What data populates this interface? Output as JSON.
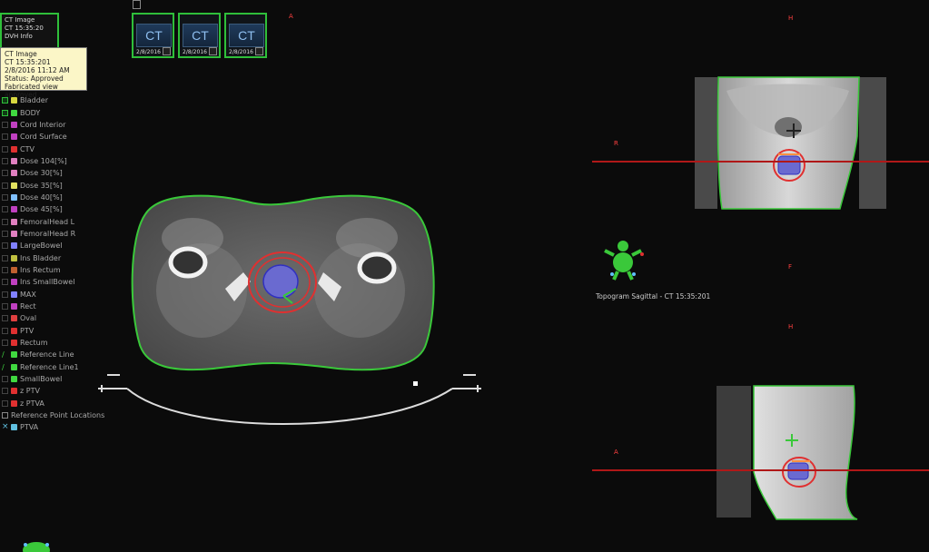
{
  "image_panel": {
    "line1": "CT Image",
    "line2": "CT 15:35:20",
    "line3": "DVH Info"
  },
  "tooltip": {
    "line1": "CT Image",
    "line2": "CT 15:35:201",
    "line3": "2/8/2016 11:12 AM",
    "line4": "Status: Approved",
    "line5": "Fabricated view approved"
  },
  "thumbnails": [
    {
      "label": "CT",
      "date": "2/8/2016"
    },
    {
      "label": "CT",
      "date": "2/8/2016"
    },
    {
      "label": "CT",
      "date": "2/8/2016"
    }
  ],
  "structures": [
    {
      "name": "Bladder",
      "color": "#d8d840",
      "check": "green"
    },
    {
      "name": "BODY",
      "color": "#40d840",
      "check": "green"
    },
    {
      "name": "Cord Interior",
      "color": "#c040c0",
      "check": "none"
    },
    {
      "name": "Cord Surface",
      "color": "#c040c0",
      "check": "none"
    },
    {
      "name": "CTV",
      "color": "#e03030",
      "check": "none"
    },
    {
      "name": "Dose 104[%]",
      "color": "#e080c0",
      "check": "none"
    },
    {
      "name": "Dose 30[%]",
      "color": "#e080c0",
      "check": "none"
    },
    {
      "name": "Dose 35[%]",
      "color": "#e0e060",
      "check": "none"
    },
    {
      "name": "Dose 40[%]",
      "color": "#80c0ff",
      "check": "none"
    },
    {
      "name": "Dose 45[%]",
      "color": "#c040c0",
      "check": "none"
    },
    {
      "name": "FemoralHead L",
      "color": "#e080c0",
      "check": "none"
    },
    {
      "name": "FemoralHead R",
      "color": "#e080c0",
      "check": "none"
    },
    {
      "name": "LargeBowel",
      "color": "#8080ff",
      "check": "none"
    },
    {
      "name": "Ins Bladder",
      "color": "#c0c040",
      "check": "none"
    },
    {
      "name": "Ins Rectum",
      "color": "#c06030",
      "check": "none"
    },
    {
      "name": "Ins SmallBowel",
      "color": "#c040c0",
      "check": "none"
    },
    {
      "name": "MAX",
      "color": "#8080ff",
      "check": "none"
    },
    {
      "name": "Rect",
      "color": "#c040c0",
      "check": "none"
    },
    {
      "name": "Oval",
      "color": "#e04040",
      "check": "none"
    },
    {
      "name": "PTV",
      "color": "#e03030",
      "check": "none"
    },
    {
      "name": "Rectum",
      "color": "#e03030",
      "check": "none"
    },
    {
      "name": "Reference Line",
      "color": "#40d840",
      "check": "line"
    },
    {
      "name": "Reference Line1",
      "color": "#40d840",
      "check": "line"
    },
    {
      "name": "SmallBowel",
      "color": "#40d840",
      "check": "none"
    },
    {
      "name": "z PTV",
      "color": "#e03030",
      "check": "none"
    },
    {
      "name": "z PTVA",
      "color": "#e03030",
      "check": "none"
    },
    {
      "name": "Reference Point Locations",
      "color": "",
      "check": "box"
    },
    {
      "name": "PTVA",
      "color": "#60c0e0",
      "check": "x"
    }
  ],
  "orientation": {
    "axial_top": "A",
    "coronal_top": "H",
    "coronal_left": "R",
    "coronal_bottom": "F",
    "sagittal_top": "H",
    "sagittal_left": "A"
  },
  "topogram_caption": "Topogram Sagittal - CT 15:35:201",
  "colors": {
    "body_contour": "#3ac83a",
    "crosshair": "#b01818",
    "ptv": "#e03030",
    "bladder_fill": "#6a6ad0",
    "rectum": "#ff9040",
    "selected_border": "#2fbf3a"
  }
}
